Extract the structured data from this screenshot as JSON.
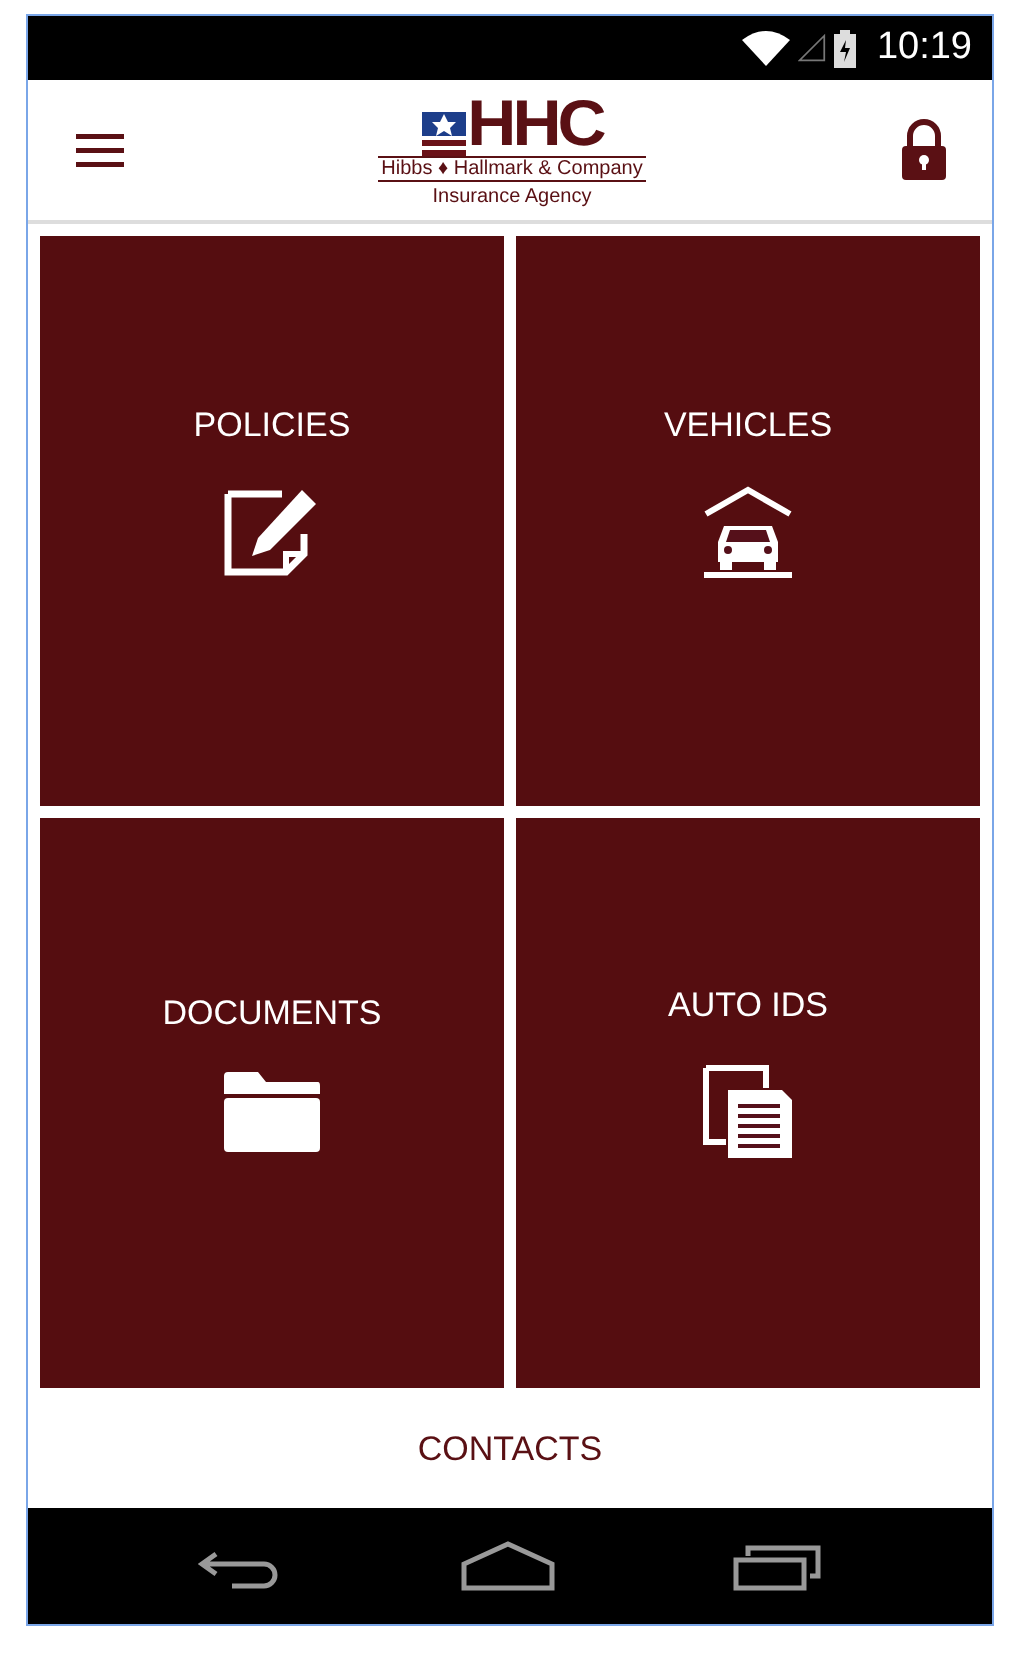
{
  "status_bar": {
    "time": "10:19"
  },
  "header": {
    "logo": {
      "mark": "HHC",
      "name": "Hibbs ♦ Hallmark & Company",
      "tagline": "Insurance Agency"
    }
  },
  "tiles": [
    {
      "label": "POLICIES",
      "kind": "policies"
    },
    {
      "label": "VEHICLES",
      "kind": "vehicles"
    },
    {
      "label": "DOCUMENTS",
      "kind": "documents"
    },
    {
      "label": "AUTO IDS",
      "kind": "autoids"
    }
  ],
  "footer_link": "CONTACTS"
}
